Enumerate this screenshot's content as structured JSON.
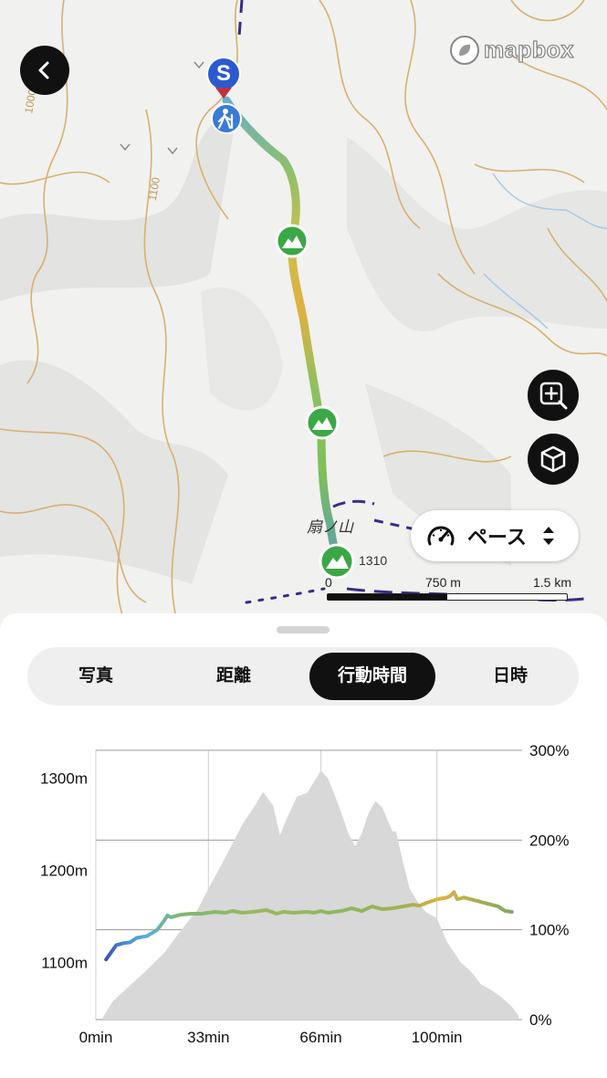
{
  "map": {
    "attribution": "mapbox",
    "peak_name": "扇ノ山",
    "peak_elevation": "1310",
    "contour_labels": [
      "1000",
      "1100"
    ],
    "scale": {
      "start": "0",
      "mid": "750 m",
      "end": "1.5 km"
    },
    "start_marker_letter": "S",
    "track_colors": [
      "#8fbf6a",
      "#c8c050",
      "#e0b040",
      "#7fbf58"
    ]
  },
  "controls": {
    "back_icon": "chevron-left-icon",
    "zoom_icon": "zoom-in-icon",
    "cube_icon": "3d-cube-icon",
    "pace_label": "ペース",
    "pace_icon": "speedometer-icon"
  },
  "tabs": [
    {
      "label": "写真",
      "active": false
    },
    {
      "label": "距離",
      "active": false
    },
    {
      "label": "行動時間",
      "active": true
    },
    {
      "label": "日時",
      "active": false
    }
  ],
  "chart_data": {
    "type": "area",
    "title": "",
    "xlabel": "",
    "ylabel": "",
    "x_ticks": [
      "0min",
      "33min",
      "66min",
      "100min"
    ],
    "y_left_ticks": [
      "1300m",
      "1200m",
      "1100m"
    ],
    "y_right_ticks": [
      "300%",
      "200%",
      "100%",
      "0%"
    ],
    "ylim_left": [
      1038,
      1330
    ],
    "ylim_right": [
      0,
      300
    ],
    "xlim": [
      0,
      125
    ],
    "series": [
      {
        "type": "area",
        "color": "#d8d8d8",
        "x": [
          2,
          5,
          10,
          15,
          20,
          25,
          30,
          33,
          38,
          43,
          47,
          49,
          52,
          54,
          56,
          59,
          62,
          64,
          66,
          68,
          70,
          72,
          74,
          76,
          78,
          80,
          82,
          84,
          87,
          88,
          90,
          92,
          95,
          97,
          100,
          103,
          107,
          110,
          113,
          116,
          119,
          122,
          124
        ],
        "y": [
          1040,
          1058,
          1075,
          1092,
          1110,
          1135,
          1158,
          1180,
          1214,
          1250,
          1272,
          1285,
          1270,
          1238,
          1256,
          1280,
          1284,
          1296,
          1308,
          1300,
          1282,
          1262,
          1240,
          1226,
          1240,
          1262,
          1275,
          1268,
          1242,
          1242,
          1210,
          1180,
          1162,
          1154,
          1148,
          1122,
          1100,
          1090,
          1076,
          1070,
          1062,
          1052,
          1042
        ]
      },
      {
        "type": "line",
        "x": [
          3,
          6,
          8,
          10,
          12,
          15,
          18,
          20,
          21,
          22,
          25,
          28,
          31,
          33,
          35,
          38,
          40,
          43,
          46,
          50,
          53,
          55,
          58,
          62,
          64,
          66,
          68,
          70,
          72,
          75,
          78,
          81,
          84,
          87,
          90,
          93,
          95,
          97,
          100,
          103,
          104,
          105,
          106,
          108,
          111,
          113,
          115,
          118,
          120,
          122
        ],
        "y": [
          67,
          83,
          85,
          86,
          91,
          93,
          100,
          110,
          116,
          114,
          117,
          118,
          118,
          119,
          120,
          119,
          121,
          119,
          120,
          122,
          118,
          120,
          119,
          120,
          119,
          121,
          119,
          120,
          121,
          124,
          121,
          126,
          123,
          124,
          126,
          128,
          127,
          130,
          134,
          136,
          138,
          142,
          134,
          136,
          133,
          131,
          129,
          126,
          121,
          120
        ],
        "colors": [
          "#3a50c0",
          "#4a90d0",
          "#5ab0d8",
          "#6cc0c8",
          "#80b870",
          "#9cb860",
          "#b8b048",
          "#e0b040",
          "#a0b058",
          "#80a860"
        ]
      }
    ]
  }
}
